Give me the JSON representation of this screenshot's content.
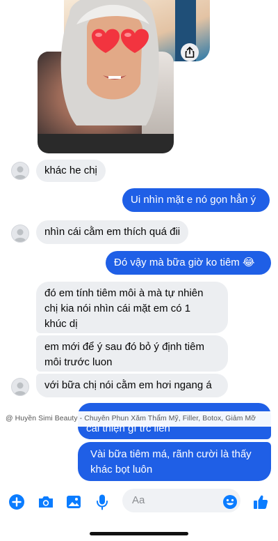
{
  "messages": [
    {
      "id": "m1",
      "dir": "in",
      "text": "khác he chị"
    },
    {
      "id": "m2",
      "dir": "out",
      "text": "Ui nhìn mặt e nó gọn hẳn ý"
    },
    {
      "id": "m3",
      "dir": "in",
      "text": "nhìn cái cằm em thích quá đii"
    },
    {
      "id": "m4",
      "dir": "out",
      "text": "Đó vậy mà bữa giờ ko tiêm 😂"
    },
    {
      "id": "m5",
      "dir": "in",
      "lines": [
        "đó em tính tiêm môi à mà tự nhiên",
        "chị kia nói nhìn cái mặt em có 1",
        "khúc dị"
      ]
    },
    {
      "id": "m6",
      "dir": "in",
      "lines": [
        "em mới để ý sau đó bỏ ý định tiêm",
        "môi trước luon"
      ]
    },
    {
      "id": "m7",
      "dir": "in",
      "text": "với bữa chị nói cằm em hơi ngang á"
    },
    {
      "id": "m8",
      "dir": "out",
      "text": "cải thiện gì trc liền"
    },
    {
      "id": "m9",
      "dir": "out",
      "lines": [
        "Vài bữa tiêm má, rãnh cười là thấy",
        "khác bọt luôn"
      ]
    }
  ],
  "watermark": "@ Huyền Simi Beauty - Chuyên Phun Xăm Thẩm Mỹ, Filler, Botox, Giảm Mỡ",
  "composer": {
    "placeholder": "Aa",
    "icons": [
      "plus-icon",
      "camera-icon",
      "image-icon",
      "microphone-icon",
      "emoji-icon",
      "thumbs-up-icon"
    ]
  },
  "colors": {
    "accent": "#1f5fe6",
    "incoming_bubble": "#eceef1",
    "messenger_blue": "#0a7cff"
  }
}
